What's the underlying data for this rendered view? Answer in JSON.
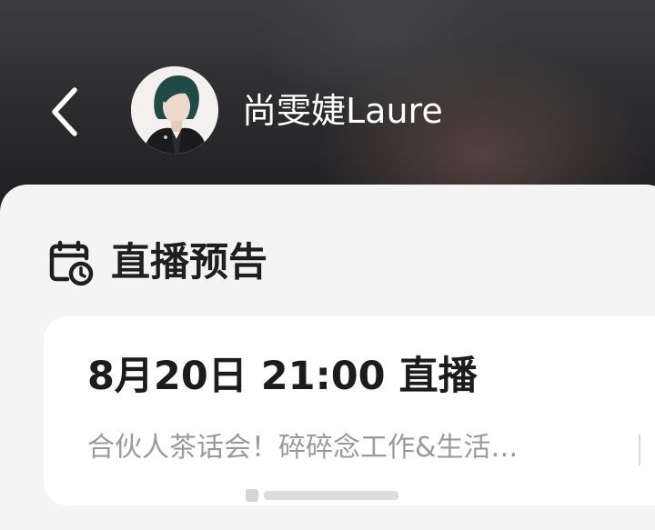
{
  "header": {
    "title": "尚雯婕Laure",
    "back_icon": "chevron-left-icon",
    "avatar": "profile-avatar"
  },
  "section": {
    "icon": "calendar-clock-icon",
    "title": "直播预告"
  },
  "live_card": {
    "time": "8月20日 21:00 直播",
    "description": "合伙人茶话会！碎碎念工作&生活…"
  },
  "colors": {
    "header_bg": "#2b2b2d",
    "sheet_bg": "#f4f4f4",
    "card_bg": "#ffffff",
    "title_text": "#ffffff",
    "primary_text": "#1c1c1c",
    "secondary_text": "#9a9a9a"
  }
}
